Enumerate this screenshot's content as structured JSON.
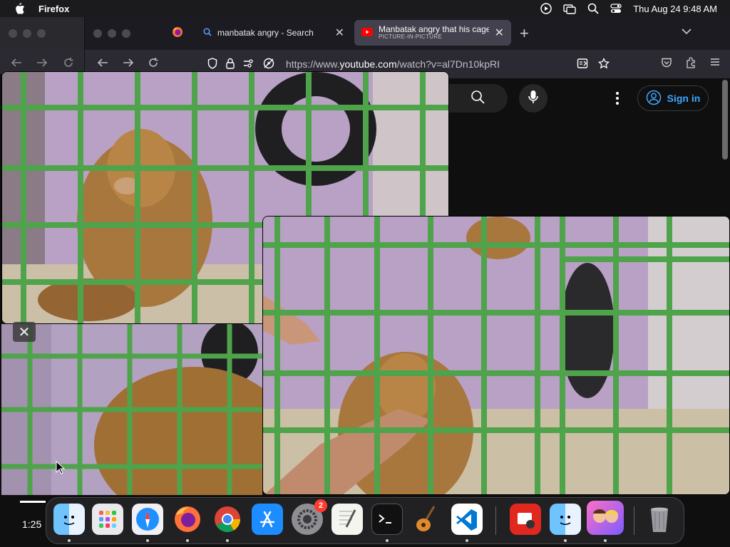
{
  "menubar": {
    "app_name": "Firefox",
    "datetime": "Thu Aug 24  9:48 AM",
    "icons": [
      "apple-icon",
      "screen-recording-icon",
      "screen-mirroring-icon",
      "spotlight-search-icon",
      "control-center-icon"
    ]
  },
  "browser": {
    "tabs": [
      {
        "label": "",
        "icon": "firefox-icon",
        "pinned": true
      },
      {
        "label": "manbatak angry - Search",
        "icon": "search-icon"
      },
      {
        "label": "Manbatak angry that his cage is",
        "sublabel": "PICTURE-IN-PICTURE",
        "icon": "youtube-icon",
        "active": true
      }
    ],
    "url": {
      "prefix": "https://www.",
      "domain": "youtube.com",
      "path": "/watch?v=al7Dn10kpRI"
    }
  },
  "youtube": {
    "sign_in": "Sign in"
  },
  "pip": {
    "time": "1:25"
  },
  "dock": {
    "items": [
      {
        "name": "finder",
        "running": true
      },
      {
        "name": "launchpad",
        "running": false
      },
      {
        "name": "safari",
        "running": true
      },
      {
        "name": "firefox",
        "running": true
      },
      {
        "name": "chrome",
        "running": true
      },
      {
        "name": "app-store",
        "running": false
      },
      {
        "name": "system-settings",
        "running": false,
        "badge": "2"
      },
      {
        "name": "textedit",
        "running": false
      },
      {
        "name": "terminal",
        "running": true
      },
      {
        "name": "garageband",
        "running": false
      },
      {
        "name": "vscode",
        "running": true
      },
      {
        "name": "photo-booth",
        "running": false
      },
      {
        "name": "finder-2",
        "running": true
      },
      {
        "name": "game-app",
        "running": true
      },
      {
        "name": "trash",
        "running": false
      }
    ]
  },
  "colors": {
    "youtube_blue": "#3ea6ff",
    "cage_green": "#4fa34a",
    "wall_purple": "#a58bb8",
    "monkey_brown": "#a8773d"
  }
}
